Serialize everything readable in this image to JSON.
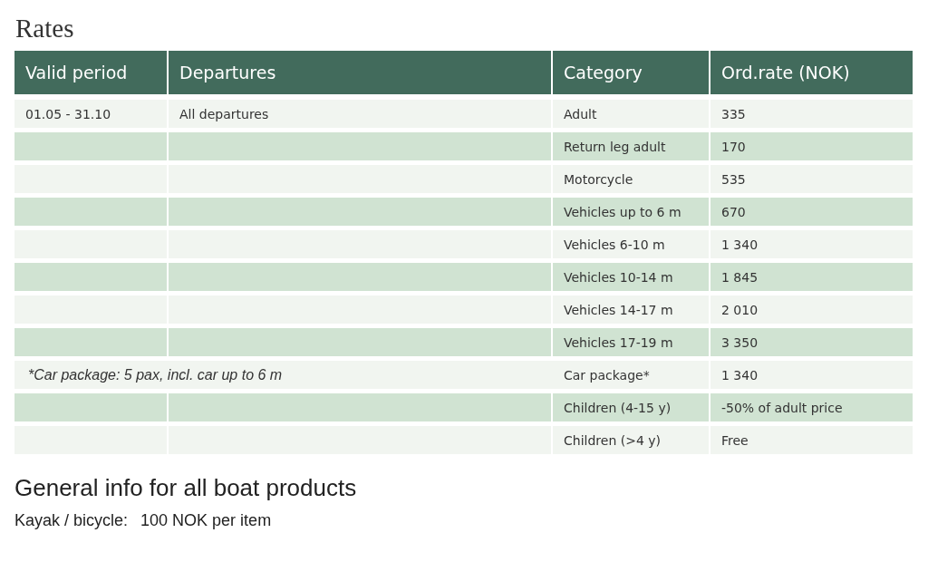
{
  "title": "Rates",
  "table": {
    "columns": [
      "Valid period",
      "Departures",
      "Category",
      "Ord.rate (NOK)"
    ],
    "rows": [
      {
        "kind": "standard",
        "cells": [
          "01.05 - 31.10",
          "All departures",
          "Adult",
          "335"
        ]
      },
      {
        "kind": "standard",
        "cells": [
          "",
          "",
          "Return leg adult",
          "170"
        ]
      },
      {
        "kind": "standard",
        "cells": [
          "",
          "",
          "Motorcycle",
          "535"
        ]
      },
      {
        "kind": "standard",
        "cells": [
          "",
          "",
          "Vehicles up to 6 m",
          "670"
        ]
      },
      {
        "kind": "standard",
        "cells": [
          "",
          "",
          "Vehicles 6-10 m",
          "1 340"
        ]
      },
      {
        "kind": "standard",
        "cells": [
          "",
          "",
          "Vehicles 10-14 m",
          "1 845"
        ]
      },
      {
        "kind": "standard",
        "cells": [
          "",
          "",
          "Vehicles 14-17 m",
          "2 010"
        ]
      },
      {
        "kind": "standard",
        "cells": [
          "",
          "",
          "Vehicles 17-19 m",
          "3 350"
        ]
      },
      {
        "kind": "note",
        "cells": [
          "*Car package: 5 pax, incl. car up to 6 m",
          "",
          "Car package*",
          "1 340"
        ]
      },
      {
        "kind": "standard",
        "cells": [
          "",
          "",
          "Children (4-15 y)",
          "-50% of adult price"
        ]
      },
      {
        "kind": "standard",
        "cells": [
          "",
          "",
          "Children (>4 y)",
          "Free"
        ]
      }
    ]
  },
  "general": {
    "heading": "General info for all boat products",
    "label": "Kayak / bicycle:",
    "value": "100 NOK per item"
  }
}
